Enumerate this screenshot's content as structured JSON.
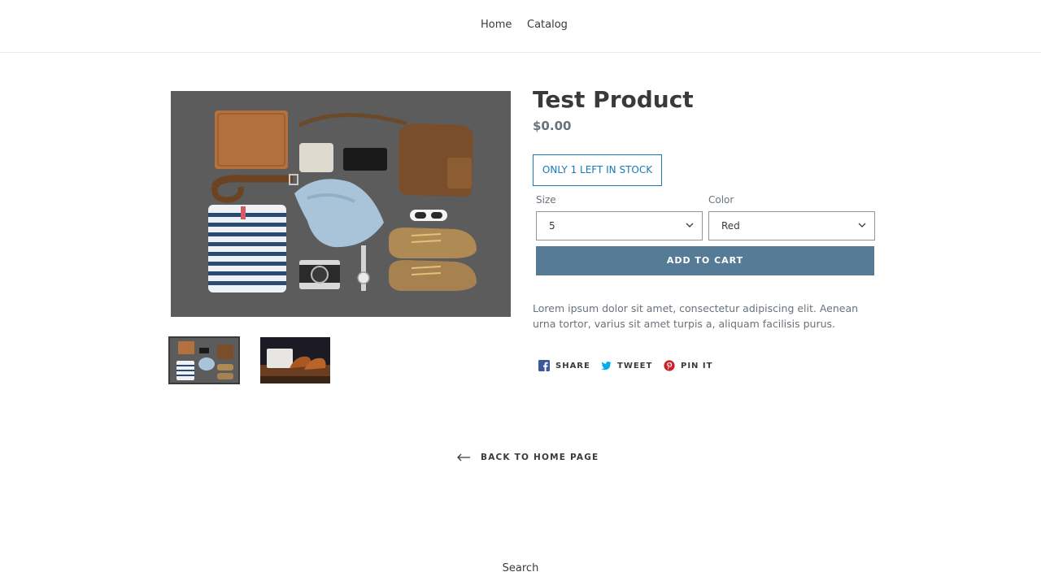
{
  "nav": {
    "items": [
      {
        "label": "Home"
      },
      {
        "label": "Catalog"
      }
    ]
  },
  "product": {
    "title": "Test Product",
    "price": "$0.00",
    "stock": "ONLY 1 LEFT IN STOCK",
    "description": "Lorem ipsum dolor sit amet, consectetur adipiscing elit. Aenean urna tortor, varius sit amet turpis a, aliquam facilisis purus.",
    "add_to_cart": "ADD TO CART",
    "options": [
      {
        "label": "Size",
        "value": "5"
      },
      {
        "label": "Color",
        "value": "Red"
      }
    ]
  },
  "share": [
    {
      "label": "SHARE",
      "icon": "facebook-icon",
      "color": "#3b5998"
    },
    {
      "label": "TWEET",
      "icon": "twitter-icon",
      "color": "#00aced"
    },
    {
      "label": "PIN IT",
      "icon": "pinterest-icon",
      "color": "#cb2027"
    }
  ],
  "back_link": "BACK TO HOME PAGE",
  "footer": {
    "search": "Search"
  },
  "colors": {
    "accent": "#557b97",
    "stock": "#1878b9",
    "text": "#3a3a3a",
    "muted": "#69727b"
  }
}
